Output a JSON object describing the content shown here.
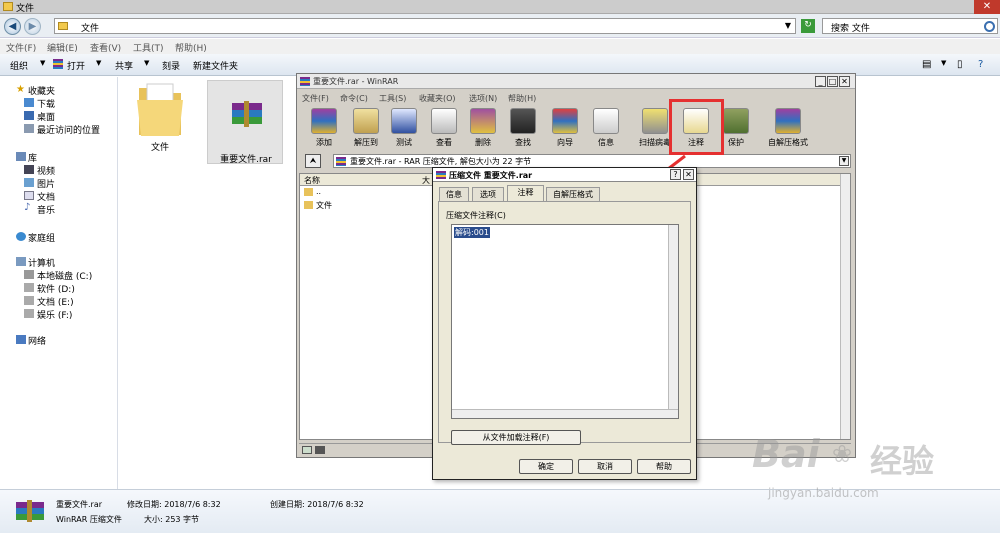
{
  "explorer": {
    "title": "文件",
    "address_path": "文件",
    "search_placeholder": "搜索 文件",
    "menu": [
      "文件(F)",
      "编辑(E)",
      "查看(V)",
      "工具(T)",
      "帮助(H)"
    ],
    "toolbar": [
      "组织",
      "打开",
      "共享",
      "刻录",
      "新建文件夹"
    ],
    "sidebar": {
      "favorites_header": "收藏夹",
      "favorites": [
        "下载",
        "桌面",
        "最近访问的位置"
      ],
      "library_header": "库",
      "libraries": [
        "视频",
        "图片",
        "文档",
        "音乐"
      ],
      "homegroup": "家庭组",
      "computer_header": "计算机",
      "drives": [
        "本地磁盘 (C:)",
        "软件 (D:)",
        "文档 (E:)",
        "娱乐 (F:)"
      ],
      "network": "网络"
    },
    "files": [
      {
        "name": "文件",
        "type": "folder"
      },
      {
        "name": "重要文件.rar",
        "type": "rar"
      }
    ],
    "details": {
      "filename": "重要文件.rar",
      "filetype": "WinRAR 压缩文件",
      "modified_label": "修改日期: 2018/7/6 8:32",
      "size_label": "大小: 253 字节",
      "created_label": "创建日期: 2018/7/6 8:32"
    }
  },
  "winrar": {
    "title": "重要文件.rar - WinRAR",
    "menu": [
      "文件(F)",
      "命令(C)",
      "工具(S)",
      "收藏夹(O)",
      "选项(N)",
      "帮助(H)"
    ],
    "tools": [
      "添加",
      "解压到",
      "测试",
      "查看",
      "删除",
      "查找",
      "向导",
      "信息",
      "扫描病毒",
      "注释",
      "保护",
      "自解压格式"
    ],
    "path_text": "重要文件.rar - RAR 压缩文件, 解包大小为 22 字节",
    "list_header_name": "名称",
    "list_header_size": "大",
    "list_items": [
      "..",
      "文件"
    ]
  },
  "dialog": {
    "title": "压缩文件 重要文件.rar",
    "tabs": [
      "信息",
      "选项",
      "注释",
      "自解压格式"
    ],
    "active_tab": "注释",
    "comment_label": "压缩文件注释(C)",
    "comment_text": "解码:001",
    "load_button": "从文件加载注释(F)",
    "ok_button": "确定",
    "cancel_button": "取消",
    "help_button": "帮助"
  },
  "watermark": {
    "brand": "Bai",
    "brand_suffix": "经验",
    "url": "jingyan.baidu.com"
  },
  "colors": {
    "highlight": "#e53030",
    "selection": "#2a4c8c"
  }
}
